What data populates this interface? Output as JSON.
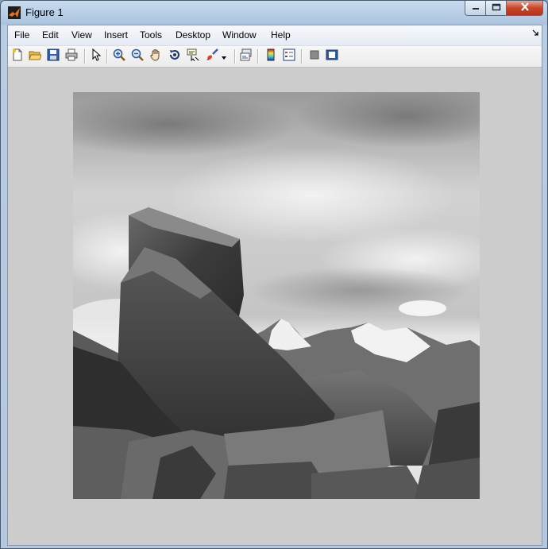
{
  "window": {
    "title": "Figure 1",
    "icons": {
      "app": "matlab-logo-icon",
      "minimize": "minimize-icon",
      "maximize": "maximize-icon",
      "close": "close-icon"
    }
  },
  "menubar": {
    "items": [
      "File",
      "Edit",
      "View",
      "Insert",
      "Tools",
      "Desktop",
      "Window",
      "Help"
    ],
    "dock_icon": "dock-arrow-icon"
  },
  "toolbar": {
    "buttons": [
      "new-figure-icon",
      "open-file-icon",
      "save-figure-icon",
      "print-figure-icon",
      "edit-plot-icon",
      "zoom-in-icon",
      "zoom-out-icon",
      "pan-icon",
      "rotate-3d-icon",
      "data-cursor-icon",
      "brush-icon",
      "brush-dropdown-icon",
      "link-plot-icon",
      "insert-colorbar-icon",
      "insert-legend-icon",
      "hide-plot-tools-icon",
      "show-plot-tools-icon"
    ]
  },
  "figure": {
    "image_subject": "grayscale photo of boulders with snowy mountain range under cloudy sky",
    "colors": {
      "background": "#cccccc"
    }
  }
}
